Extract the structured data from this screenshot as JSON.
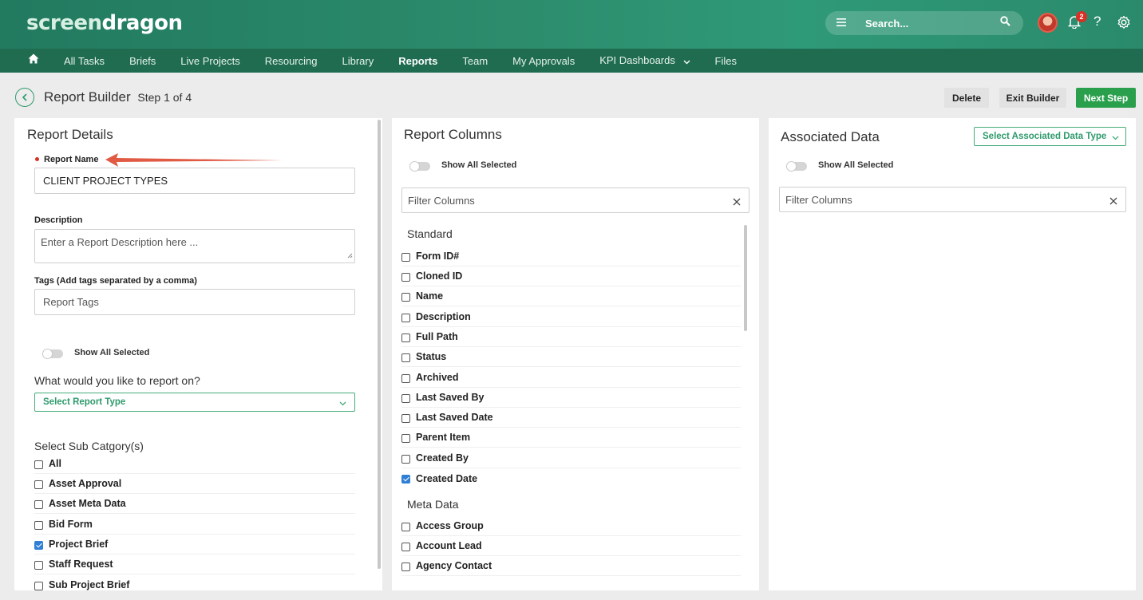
{
  "app": {
    "logo_part1": "screen",
    "logo_part2": "dragon"
  },
  "header": {
    "search_placeholder": "Search...",
    "notification_count": "2",
    "help": "?"
  },
  "nav": [
    {
      "label": "All Tasks",
      "active": false
    },
    {
      "label": "Briefs",
      "active": false
    },
    {
      "label": "Live Projects",
      "active": false
    },
    {
      "label": "Resourcing",
      "active": false
    },
    {
      "label": "Library",
      "active": false
    },
    {
      "label": "Reports",
      "active": true
    },
    {
      "label": "Team",
      "active": false
    },
    {
      "label": "My Approvals",
      "active": false
    },
    {
      "label": "KPI Dashboards",
      "active": false,
      "dropdown": true
    },
    {
      "label": "Files",
      "active": false
    }
  ],
  "page": {
    "title": "Report Builder",
    "step": "Step 1 of 4"
  },
  "actions": {
    "delete": "Delete",
    "exit": "Exit Builder",
    "next": "Next Step"
  },
  "details": {
    "title": "Report Details",
    "name_label": "Report Name",
    "name_value": "CLIENT PROJECT TYPES",
    "description_label": "Description",
    "description_placeholder": "Enter a Report Description here ...",
    "tags_label": "Tags (Add tags separated by a comma)",
    "tags_placeholder": "Report Tags",
    "show_all_selected": "Show All Selected",
    "question": "What would you like to report on?",
    "report_type_placeholder": "Select Report Type",
    "subcat_title": "Select Sub Catgory(s)",
    "subcategories": [
      {
        "label": "All",
        "checked": false
      },
      {
        "label": "Asset Approval",
        "checked": false
      },
      {
        "label": "Asset Meta Data",
        "checked": false
      },
      {
        "label": "Bid Form",
        "checked": false
      },
      {
        "label": "Project Brief",
        "checked": true
      },
      {
        "label": "Staff Request",
        "checked": false
      },
      {
        "label": "Sub Project Brief",
        "checked": false
      }
    ]
  },
  "columns": {
    "title": "Report Columns",
    "show_all_selected": "Show All Selected",
    "filter_placeholder": "Filter Columns",
    "standard_title": "Standard",
    "standard": [
      {
        "label": "Form ID#",
        "checked": false
      },
      {
        "label": "Cloned ID",
        "checked": false
      },
      {
        "label": "Name",
        "checked": false
      },
      {
        "label": "Description",
        "checked": false
      },
      {
        "label": "Full Path",
        "checked": false
      },
      {
        "label": "Status",
        "checked": false
      },
      {
        "label": "Archived",
        "checked": false
      },
      {
        "label": "Last Saved By",
        "checked": false
      },
      {
        "label": "Last Saved Date",
        "checked": false
      },
      {
        "label": "Parent Item",
        "checked": false
      },
      {
        "label": "Created By",
        "checked": false
      },
      {
        "label": "Created Date",
        "checked": true
      }
    ],
    "meta_title": "Meta Data",
    "meta": [
      {
        "label": "Access Group",
        "checked": false
      },
      {
        "label": "Account Lead",
        "checked": false
      },
      {
        "label": "Agency Contact",
        "checked": false
      }
    ]
  },
  "associated": {
    "title": "Associated Data",
    "select_label": "Select Associated Data Type",
    "show_all_selected": "Show All Selected",
    "filter_placeholder": "Filter Columns"
  },
  "colors": {
    "brand_dark": "#1f6c50",
    "brand": "#2a8a6b",
    "accent_green": "#2aa04d",
    "checkbox_blue": "#2f7fd4",
    "arrow_red": "#e05a44"
  },
  "icons": [
    "home-icon",
    "menu-icon",
    "search-icon",
    "bell-icon",
    "help-icon",
    "gear-icon",
    "back-circle-icon",
    "chevron-down-icon",
    "close-icon",
    "arrow-annotation"
  ]
}
